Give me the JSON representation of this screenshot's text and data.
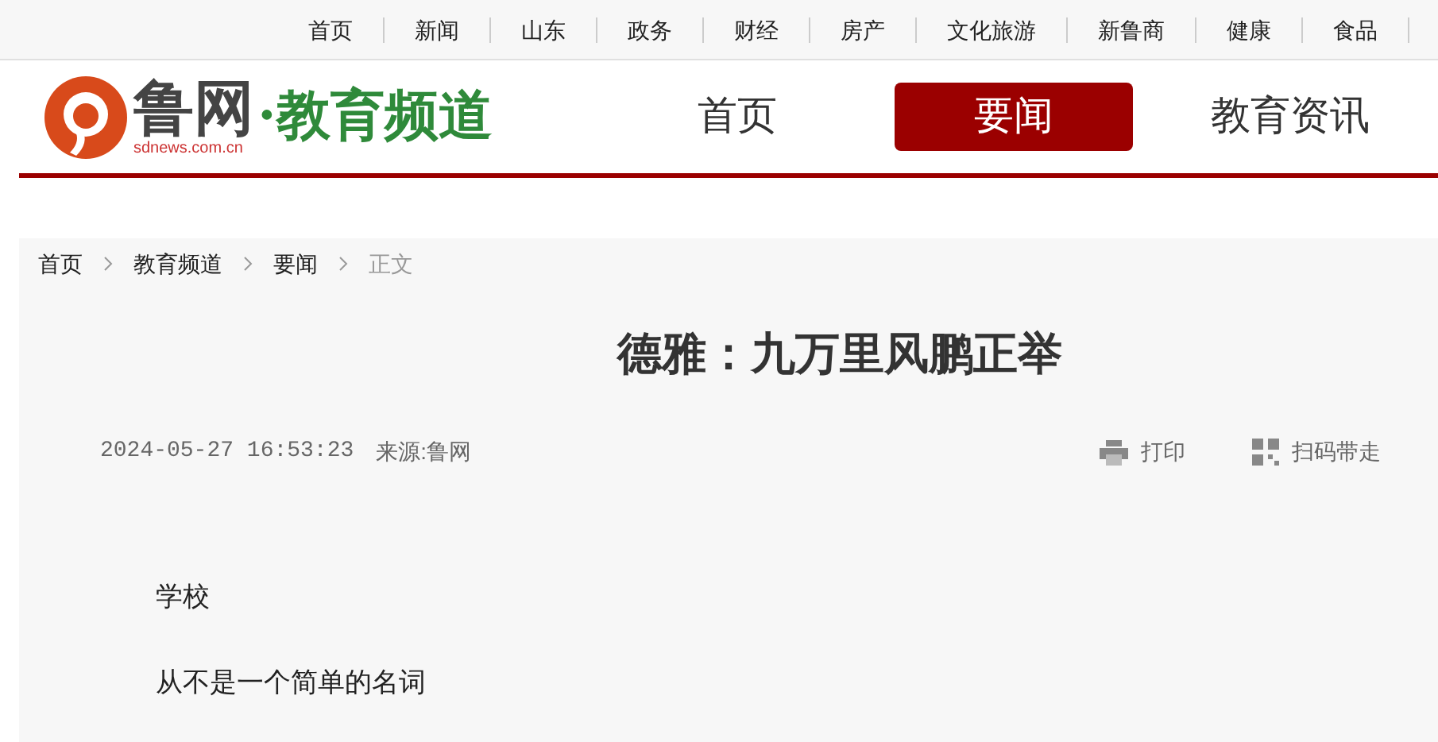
{
  "top_nav": [
    "首页",
    "新闻",
    "山东",
    "政务",
    "财经",
    "房产",
    "文化旅游",
    "新鲁商",
    "健康",
    "食品"
  ],
  "logo": {
    "name": "鲁网",
    "domain": "sdnews.com.cn",
    "channel": "·教育频道"
  },
  "main_nav": [
    {
      "label": "首页",
      "selected": false
    },
    {
      "label": "要闻",
      "selected": true
    },
    {
      "label": "教育资讯",
      "selected": false
    }
  ],
  "breadcrumb": [
    {
      "label": "首页",
      "current": false
    },
    {
      "label": "教育频道",
      "current": false
    },
    {
      "label": "要闻",
      "current": false
    },
    {
      "label": "正文",
      "current": true
    }
  ],
  "article": {
    "title": "德雅：九万里风鹏正举",
    "datetime": "2024-05-27 16:53:23",
    "source": "来源:鲁网",
    "print": "打印",
    "scan": "扫码带走",
    "paragraphs": [
      "学校",
      "从不是一个简单的名词"
    ]
  }
}
